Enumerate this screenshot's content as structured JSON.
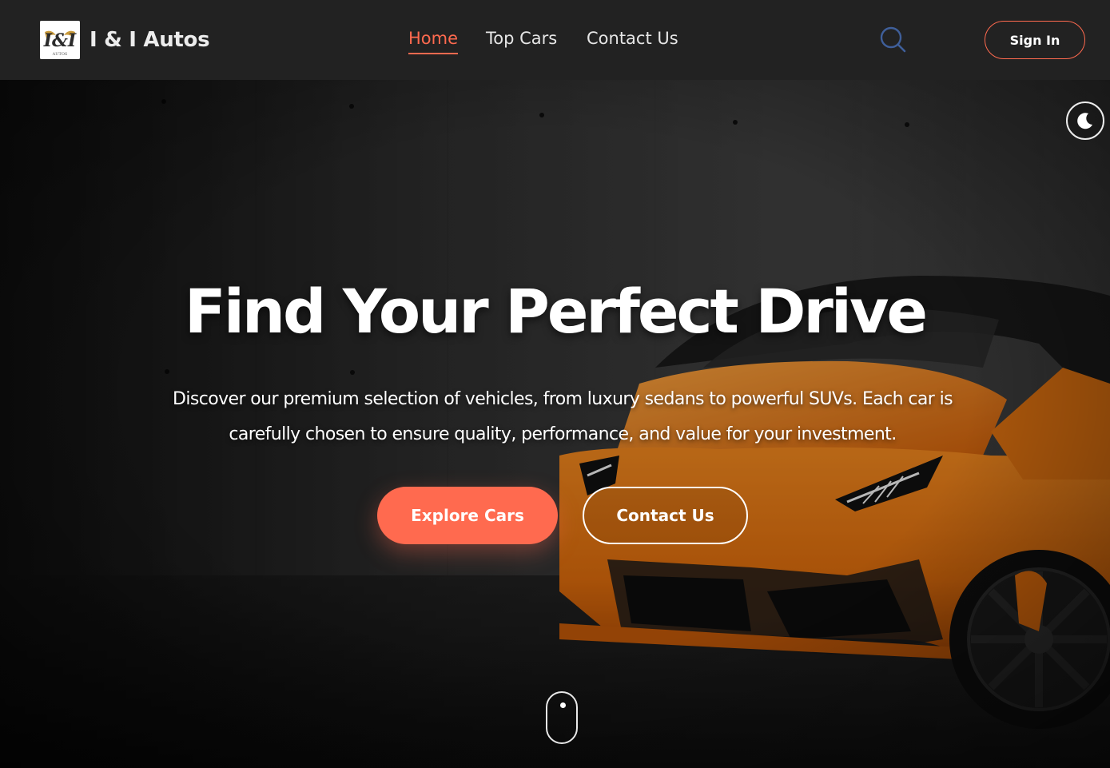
{
  "header": {
    "brand": "I & I Autos",
    "logo_text": "I&I",
    "logo_subtext": "AUTOS",
    "nav": [
      {
        "label": "Home",
        "active": true
      },
      {
        "label": "Top Cars",
        "active": false
      },
      {
        "label": "Contact Us",
        "active": false
      }
    ],
    "search_icon": "search-icon",
    "sign_in_label": "Sign In"
  },
  "hero": {
    "title": "Find Your Perfect Drive",
    "description": "Discover our premium selection of vehicles, from luxury sedans to powerful SUVs. Each car is carefully chosen to ensure quality, performance, and value for your investment.",
    "primary_button": "Explore Cars",
    "secondary_button": "Contact Us",
    "theme_toggle_icon": "moon-icon",
    "scroll_icon": "mouse-scroll-icon"
  },
  "colors": {
    "accent": "#ff6a4f",
    "header_bg": "#222222",
    "car_orange": "#f07a10",
    "text": "#ffffff"
  }
}
